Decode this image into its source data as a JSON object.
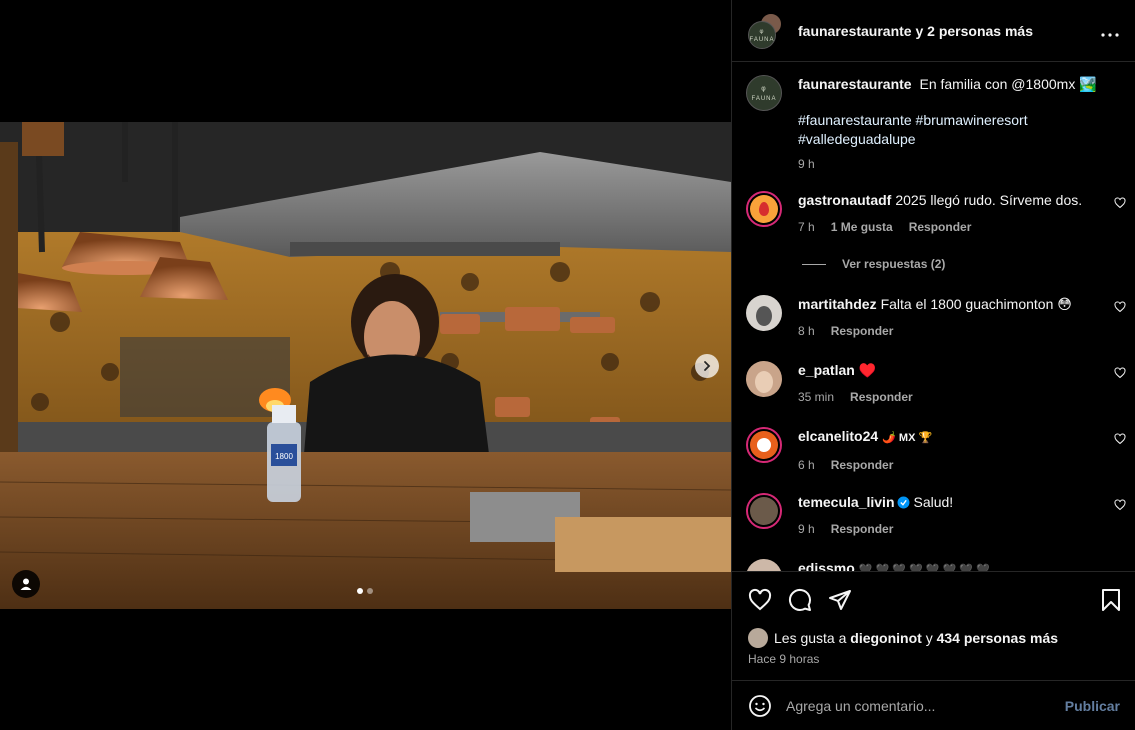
{
  "header": {
    "title": "faunarestaurante y 2 personas más",
    "more_icon": "more-horizontal-icon",
    "avatar_text": "FAUNA"
  },
  "caption": {
    "username": "faunarestaurante",
    "text": "En familia con @1800mx 🏞️",
    "hashtags": "#faunarestaurante #brumawineresort #valledeguadalupe",
    "time": "9 h"
  },
  "comments": [
    {
      "username": "gastronautadf",
      "text": "2025 llegó rudo. Sírveme dos.",
      "time": "7 h",
      "likes": "1 Me gusta",
      "reply": "Responder"
    },
    {
      "username": "martitahdez",
      "text": "Falta el 1800 guachimonton 😳",
      "time": "8 h",
      "reply": "Responder"
    },
    {
      "username": "e_patlan",
      "text": "♥️",
      "time": "35 min",
      "reply": "Responder"
    },
    {
      "username": "elcanelito24",
      "text": "🌶️ MX 🏆",
      "time": "6 h",
      "reply": "Responder"
    },
    {
      "username": "temecula_livin",
      "text": "Salud!",
      "time": "9 h",
      "reply": "Responder"
    },
    {
      "username": "edissmo",
      "text": "🖤 🖤 🖤 🖤 🖤 🖤 🖤 🖤"
    }
  ],
  "view_replies": "Ver respuestas (2)",
  "likes": {
    "prefix": "Les gusta a",
    "user": "diegoninot",
    "conj": "y",
    "others": "434 personas más"
  },
  "time_ago": "Hace 9 horas",
  "comment_box": {
    "placeholder": "Agrega un comentario...",
    "publish": "Publicar"
  },
  "bottle_label": "1800",
  "carousel": {
    "current": 1,
    "total": 2
  },
  "colors": {
    "background": "#000000",
    "border": "#262626",
    "secondary_text": "#a8a8a8",
    "publish": "#85a9d6"
  }
}
